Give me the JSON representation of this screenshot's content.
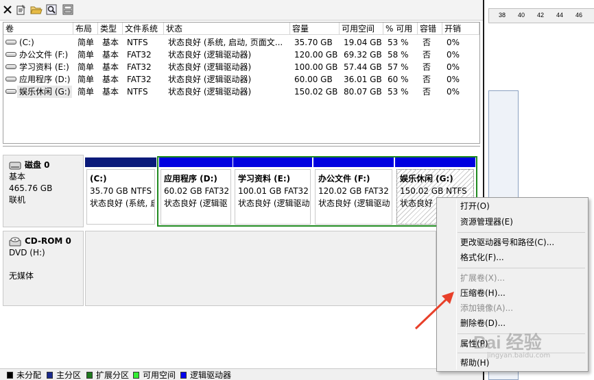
{
  "toolbar": {
    "icons": [
      "close-icon",
      "properties-icon",
      "open-folder-icon",
      "search-icon",
      "disk-icon"
    ]
  },
  "right_window": {
    "ruler_labels": [
      "38",
      "40",
      "42",
      "44",
      "46"
    ]
  },
  "volume_table": {
    "headers": [
      "卷",
      "布局",
      "类型",
      "文件系统",
      "状态",
      "容量",
      "可用空间",
      "% 可用",
      "容错",
      "开销"
    ],
    "rows": [
      [
        "(C:)",
        "简单",
        "基本",
        "NTFS",
        "状态良好 (系统, 启动, 页面文...",
        "35.70 GB",
        "19.04 GB",
        "53 %",
        "否",
        "0%"
      ],
      [
        "办公文件 (F:)",
        "简单",
        "基本",
        "FAT32",
        "状态良好 (逻辑驱动器)",
        "120.00 GB",
        "69.32 GB",
        "58 %",
        "否",
        "0%"
      ],
      [
        "学习资料 (E:)",
        "简单",
        "基本",
        "FAT32",
        "状态良好 (逻辑驱动器)",
        "100.00 GB",
        "57.44 GB",
        "57 %",
        "否",
        "0%"
      ],
      [
        "应用程序 (D:)",
        "简单",
        "基本",
        "FAT32",
        "状态良好 (逻辑驱动器)",
        "60.00 GB",
        "36.01 GB",
        "60 %",
        "否",
        "0%"
      ],
      [
        "娱乐休闲 (G:)",
        "简单",
        "基本",
        "NTFS",
        "状态良好 (逻辑驱动器)",
        "150.02 GB",
        "80.07 GB",
        "53 %",
        "否",
        "0%"
      ]
    ]
  },
  "disk0": {
    "title": "磁盘 0",
    "type": "基本",
    "size": "465.76 GB",
    "status": "联机",
    "partitions": [
      {
        "title": "(C:)",
        "size": "35.70 GB NTFS",
        "status": "状态良好 (系统, 启"
      },
      {
        "title": "应用程序  (D:)",
        "size": "60.02 GB FAT32",
        "status": "状态良好 (逻辑驱"
      },
      {
        "title": "学习资料  (E:)",
        "size": "100.01 GB FAT32",
        "status": "状态良好 (逻辑驱动"
      },
      {
        "title": "办公文件  (F:)",
        "size": "120.02 GB FAT32",
        "status": "状态良好 (逻辑驱动"
      },
      {
        "title": "娱乐休闲  (G:)",
        "size": "150.02 GB NTFS",
        "status": "状态良好"
      }
    ]
  },
  "cdrom0": {
    "title": "CD-ROM 0",
    "drive": "DVD (H:)",
    "media": "无媒体"
  },
  "context_menu": {
    "items": [
      {
        "label": "打开(O)",
        "enabled": true
      },
      {
        "label": "资源管理器(E)",
        "enabled": true
      },
      {
        "label": "更改驱动器号和路径(C)...",
        "enabled": true
      },
      {
        "label": "格式化(F)...",
        "enabled": true
      },
      {
        "label": "扩展卷(X)...",
        "enabled": false
      },
      {
        "label": "压缩卷(H)...",
        "enabled": true
      },
      {
        "label": "添加镜像(A)...",
        "enabled": false
      },
      {
        "label": "删除卷(D)...",
        "enabled": true
      },
      {
        "label": "属性(P)",
        "enabled": true
      },
      {
        "label": "帮助(H)",
        "enabled": true
      }
    ]
  },
  "legend": {
    "items": [
      {
        "label": "未分配",
        "color": "#000000"
      },
      {
        "label": "主分区",
        "color": "#1a2a8c"
      },
      {
        "label": "扩展分区",
        "color": "#1f7a1f"
      },
      {
        "label": "可用空间",
        "color": "#33ee33"
      },
      {
        "label": "逻辑驱动器",
        "color": "#0000ee"
      }
    ]
  },
  "colors": {
    "primary_partition": "#0a1a7a",
    "logical_drive": "#0000e0",
    "extended_partition": "#1f8a1f",
    "arrow": "#e8402a"
  },
  "watermark": {
    "text": "Bai 经验",
    "url_text": "jingyan.baidu.com"
  }
}
